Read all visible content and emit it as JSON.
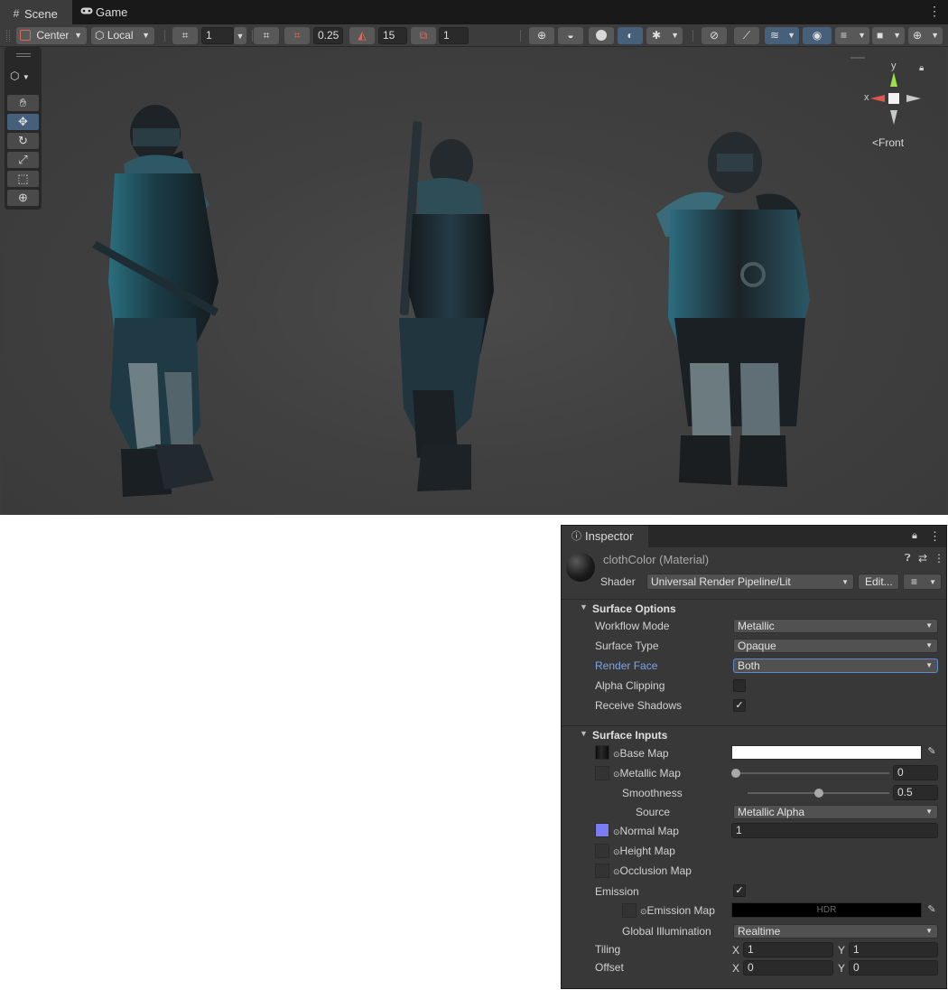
{
  "tabs": [
    {
      "label": "Scene",
      "icon": "grid-icon"
    },
    {
      "label": "Game",
      "icon": "gamepad-icon"
    }
  ],
  "toolbar": {
    "pivot_label": "Center",
    "space_label": "Local",
    "grid_size": "1",
    "snap_increment": "0.25",
    "rotate_snap": "15",
    "scale_snap": "1"
  },
  "gizmo": {
    "view_label": "Front",
    "y_label": "y",
    "x_label": "x"
  },
  "inspector": {
    "tab_label": "Inspector",
    "object_title": "clothColor (Material)",
    "shader_label": "Shader",
    "shader_value": "Universal Render Pipeline/Lit",
    "edit_label": "Edit...",
    "surface_options": {
      "header": "Surface Options",
      "workflow_label": "Workflow Mode",
      "workflow_value": "Metallic",
      "surface_type_label": "Surface Type",
      "surface_type_value": "Opaque",
      "render_face_label": "Render Face",
      "render_face_value": "Both",
      "alpha_clipping_label": "Alpha Clipping",
      "alpha_clipping": false,
      "receive_shadows_label": "Receive Shadows",
      "receive_shadows": true
    },
    "surface_inputs": {
      "header": "Surface Inputs",
      "base_map_label": "Base Map",
      "base_color": "#ffffff",
      "metallic_map_label": "Metallic Map",
      "metallic_value": "0",
      "metallic_fraction": 0.0,
      "smoothness_label": "Smoothness",
      "smoothness_value": "0.5",
      "smoothness_fraction": 0.5,
      "source_label": "Source",
      "source_value": "Metallic Alpha",
      "normal_map_label": "Normal Map",
      "normal_value": "1",
      "height_map_label": "Height Map",
      "occlusion_map_label": "Occlusion Map",
      "emission_label": "Emission",
      "emission_enabled": true,
      "emission_map_label": "Emission Map",
      "emission_hdr_label": "HDR",
      "gi_label": "Global Illumination",
      "gi_value": "Realtime",
      "tiling_label": "Tiling",
      "tiling_x": "1",
      "tiling_y": "1",
      "offset_label": "Offset",
      "offset_x": "0",
      "offset_y": "0",
      "x_axis": "X",
      "y_axis": "Y"
    }
  },
  "colors": {
    "accent_blue": "#46607c",
    "highlight_label": "#7ba7e8",
    "gizmo_y": "#9ae34a",
    "gizmo_x": "#e0564c"
  }
}
